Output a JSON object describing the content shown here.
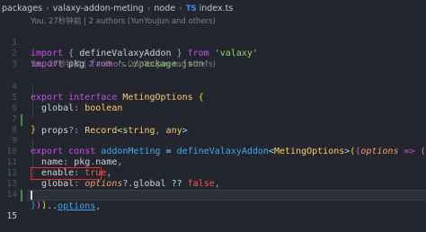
{
  "breadcrumb": {
    "items": [
      "packages",
      "valaxy-addon-meting",
      "node"
    ],
    "file_icon": "TS",
    "file": "index.ts"
  },
  "codelens": [
    "You, 27秒钟前 | 2 authors (YunYouJun and others)",
    "You, 27秒钟前 | 2 authors (YunYouJun and others)"
  ],
  "gutter": [
    "1",
    "2",
    "3",
    "4",
    "5",
    "6",
    "7",
    "8",
    "9",
    "10",
    "11",
    "12",
    "13",
    "14",
    "15"
  ],
  "code": {
    "l1": {
      "kw": "import",
      "open": " { ",
      "name": "defineValaxyAddon",
      "close": " } ",
      "from": "from",
      "str": "'valaxy'"
    },
    "l2": {
      "kw": "import",
      "name": " pkg ",
      "from": "from",
      "str": "'../package.json'"
    },
    "l4": {
      "export": "export",
      "interface": "interface",
      "name": "MetingOptions",
      "brace": "{"
    },
    "l5": {
      "prop": "global",
      "colon": ": ",
      "type": "boolean"
    },
    "l6": {
      "prop": "props",
      "q": "?: ",
      "type": "Record",
      "lt": "<",
      "t1": "string",
      "comma": ", ",
      "t2": "any",
      "gt": ">"
    },
    "l7": {
      "brace": "}"
    },
    "l9": {
      "export": "export",
      "const": "const",
      "name": "addonMeting",
      "eq": " = ",
      "fn": "defineValaxyAddon",
      "lt": "<",
      "type": "MetingOptions",
      "gt": ">",
      "p1": "(",
      "param": "options",
      "arrow": " => ",
      "p2": "(",
      "b": "{"
    },
    "l10": {
      "prop": "name",
      "colon": ": ",
      "obj": "pkg",
      "dot": ".",
      "field": "name",
      "comma": ","
    },
    "l11": {
      "prop": "enable",
      "colon": ": ",
      "val": "true",
      "comma": ","
    },
    "l12": {
      "prop": "global",
      "colon": ": ",
      "obj": "options",
      "op1": "?.",
      "field": "global",
      "op2": " ?? ",
      "val": "false",
      "comma": ","
    },
    "l13": {
      "spread": "...",
      "obj": "options",
      "comma": ","
    },
    "l14": {
      "close": "}))"
    }
  },
  "colors": {
    "background": "#23262e",
    "keyword": "#c74ded",
    "string": "#95d56a",
    "type": "#ffcb6b",
    "function": "#43a8ec",
    "highlight_box": "#e0322d"
  }
}
